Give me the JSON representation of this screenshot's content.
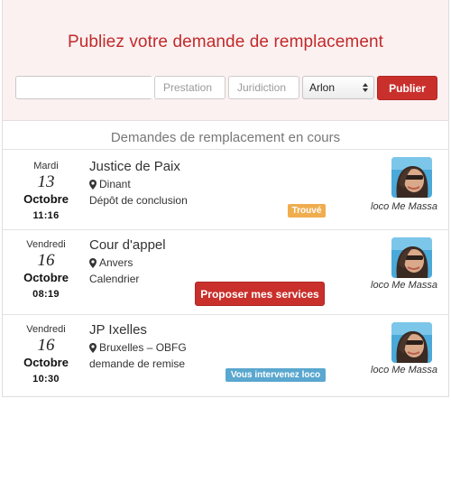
{
  "form": {
    "title": "Publiez votre demande de remplacement",
    "date_value": "",
    "prestation_placeholder": "Prestation",
    "juridiction_placeholder": "Juridiction",
    "city_selected": "Arlon",
    "publish_label": "Publier"
  },
  "list": {
    "header": "Demandes de remplacement en cours",
    "items": [
      {
        "weekday": "Mardi",
        "day": "13",
        "month": "Octobre",
        "time": "11:16",
        "court": "Justice de Paix",
        "city": "Dinant",
        "task": "Dépôt de conclusion",
        "badge": "Trouvé",
        "person": "loco Me Massa"
      },
      {
        "weekday": "Vendredi",
        "day": "16",
        "month": "Octobre",
        "time": "08:19",
        "court": "Cour d'appel",
        "city": "Anvers",
        "task": "Calendrier",
        "action": "Proposer mes services",
        "person": "loco Me Massa"
      },
      {
        "weekday": "Vendredi",
        "day": "16",
        "month": "Octobre",
        "time": "10:30",
        "court": "JP Ixelles",
        "city": "Bruxelles – OBFG",
        "task": "demande de remise",
        "badge": "Vous intervenez loco",
        "person": "loco Me Massa"
      }
    ]
  },
  "colors": {
    "brand_red": "#c9302c",
    "title_red": "#c12a2a",
    "hero_bg": "#fcf1f1",
    "badge_found": "#f0ad4e",
    "badge_assigned": "#5aa7cf"
  },
  "icons": {
    "date_addon": "calendar-icon",
    "location": "map-pin-icon",
    "select": "select-arrows-icon"
  }
}
